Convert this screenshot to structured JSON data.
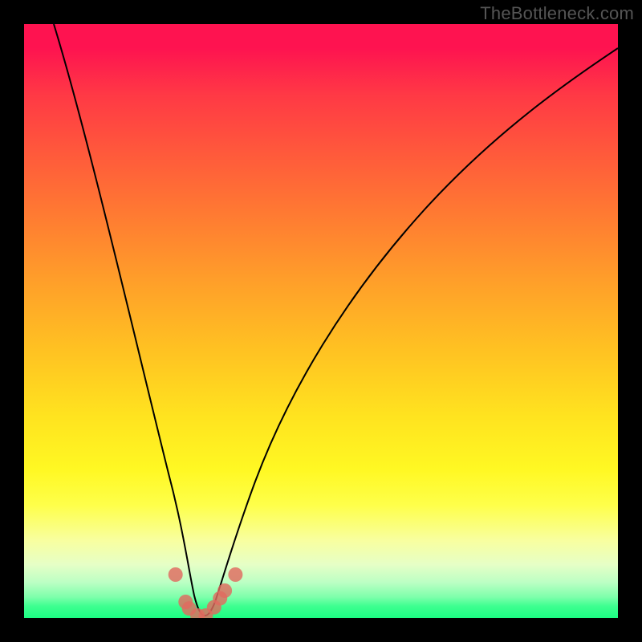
{
  "watermark": "TheBottleneck.com",
  "chart_data": {
    "type": "line",
    "title": "",
    "xlabel": "",
    "ylabel": "",
    "xlim": [
      0,
      100
    ],
    "ylim": [
      0,
      100
    ],
    "grid": false,
    "legend": false,
    "series": [
      {
        "name": "left-branch",
        "x": [
          5,
          8,
          11,
          14,
          17,
          20,
          22,
          24,
          25.5,
          26.5,
          27.5,
          28.5
        ],
        "y": [
          100,
          86,
          72,
          58,
          44,
          30,
          20,
          12,
          7,
          4,
          2,
          1
        ]
      },
      {
        "name": "right-branch",
        "x": [
          31,
          32.5,
          34,
          36,
          39,
          43,
          48,
          54,
          61,
          69,
          78,
          88,
          100
        ],
        "y": [
          1,
          2,
          4,
          7,
          12,
          19,
          27,
          36,
          46,
          56,
          66,
          76,
          87
        ]
      },
      {
        "name": "valley-floor",
        "x": [
          28.5,
          29,
          30,
          30.5,
          31
        ],
        "y": [
          1,
          0.4,
          0.2,
          0.4,
          1
        ]
      }
    ],
    "points": [
      {
        "name": "dot-left-upper",
        "x": 25.5,
        "y": 7.3
      },
      {
        "name": "dot-left-mid1",
        "x": 27.2,
        "y": 2.7
      },
      {
        "name": "dot-left-mid2",
        "x": 27.8,
        "y": 1.6
      },
      {
        "name": "dot-floor-1",
        "x": 29.2,
        "y": 0.4
      },
      {
        "name": "dot-floor-2",
        "x": 30.6,
        "y": 0.4
      },
      {
        "name": "dot-right-1",
        "x": 32.0,
        "y": 1.8
      },
      {
        "name": "dot-right-2",
        "x": 33.0,
        "y": 3.3
      },
      {
        "name": "dot-right-3",
        "x": 33.8,
        "y": 4.6
      },
      {
        "name": "dot-right-upper",
        "x": 35.6,
        "y": 7.3
      }
    ],
    "colors": {
      "curve": "#000000",
      "dots": "#e06a5f",
      "gradient_top": "#fe1350",
      "gradient_bottom": "#1cfd83"
    }
  }
}
